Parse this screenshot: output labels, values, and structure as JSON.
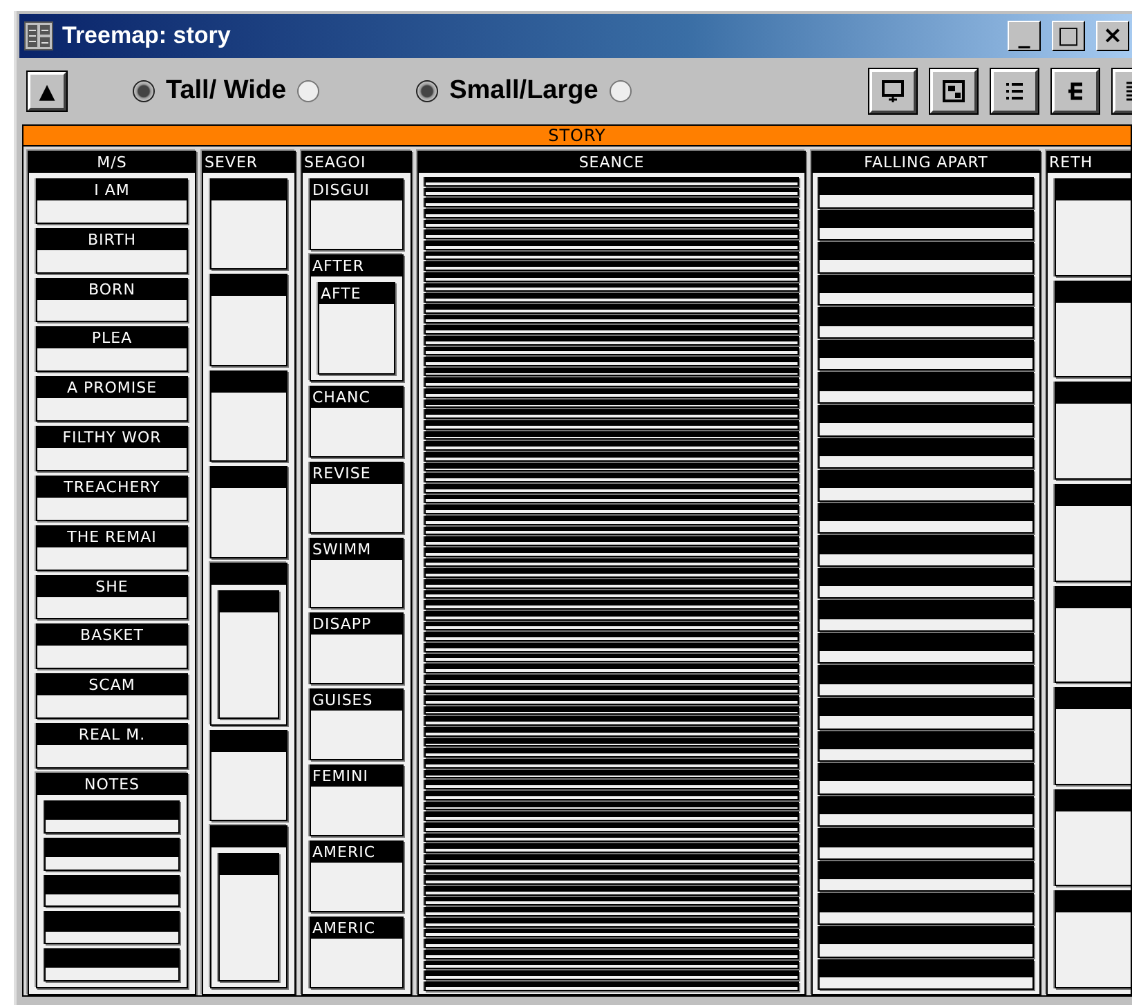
{
  "window": {
    "title": "Treemap: story",
    "controls": [
      "_",
      "□",
      "×"
    ]
  },
  "toolbar": {
    "up_button": "▲",
    "toggles": [
      {
        "label": "Tall/ Wide",
        "options": [
          {
            "selected": true
          },
          {
            "selected": false
          }
        ]
      },
      {
        "label": "Small/Large",
        "options": [
          {
            "selected": true
          },
          {
            "selected": false
          }
        ]
      }
    ],
    "tools": [
      {
        "kind": "presentation"
      },
      {
        "kind": "layout"
      },
      {
        "kind": "list"
      },
      {
        "kind": "tree"
      },
      {
        "kind": "text"
      }
    ]
  },
  "treemap": {
    "label": "STORY",
    "children": [
      {
        "kind": "group",
        "label": "M/S",
        "children": [
          {
            "kind": "leaf",
            "label": "I AM"
          },
          {
            "kind": "leaf",
            "label": "BIRTH"
          },
          {
            "kind": "leaf",
            "label": "BORN"
          },
          {
            "kind": "leaf",
            "label": "PLEA"
          },
          {
            "kind": "leaf",
            "label": "A PROMISE"
          },
          {
            "kind": "leaf",
            "label": "FILTHY WOR"
          },
          {
            "kind": "leaf",
            "label": "TREACHERY"
          },
          {
            "kind": "leaf",
            "label": "THE REMAI"
          },
          {
            "kind": "leaf",
            "label": "SHE"
          },
          {
            "kind": "leaf",
            "label": "BASKET"
          },
          {
            "kind": "leaf",
            "label": "SCAM"
          },
          {
            "kind": "leaf",
            "label": "REAL M."
          },
          {
            "kind": "group",
            "label": "NOTES",
            "children": [
              {
                "kind": "leaf"
              },
              {
                "kind": "leaf"
              },
              {
                "kind": "leaf"
              },
              {
                "kind": "leaf"
              },
              {
                "kind": "leaf"
              }
            ]
          }
        ]
      },
      {
        "kind": "group",
        "label": "SEVER",
        "children": [
          {
            "kind": "leaf"
          },
          {
            "kind": "leaf"
          },
          {
            "kind": "leaf"
          },
          {
            "kind": "leaf"
          },
          {
            "kind": "group",
            "children": [
              {
                "kind": "leaf"
              }
            ]
          },
          {
            "kind": "leaf"
          },
          {
            "kind": "group",
            "children": [
              {
                "kind": "leaf"
              }
            ]
          }
        ]
      },
      {
        "kind": "group",
        "label": "SEAGOI",
        "children": [
          {
            "kind": "leaf",
            "label": "DISGUI"
          },
          {
            "kind": "group",
            "label": "AFTER",
            "children": [
              {
                "kind": "leaf",
                "label": "AFTE"
              }
            ]
          },
          {
            "kind": "leaf",
            "label": "CHANC"
          },
          {
            "kind": "leaf",
            "label": "REVISE"
          },
          {
            "kind": "leaf",
            "label": "SWIMM"
          },
          {
            "kind": "leaf",
            "label": "DISAPP"
          },
          {
            "kind": "leaf",
            "label": "GUISES"
          },
          {
            "kind": "leaf",
            "label": "FEMINI"
          },
          {
            "kind": "leaf",
            "label": "AMERIC"
          },
          {
            "kind": "leaf",
            "label": "AMERIC"
          }
        ]
      },
      {
        "kind": "group",
        "label": "SEANCE",
        "children": [
          {
            "kind": "leaf"
          },
          {
            "kind": "leaf"
          },
          {
            "kind": "leaf"
          },
          {
            "kind": "leaf"
          },
          {
            "kind": "leaf"
          },
          {
            "kind": "leaf"
          },
          {
            "kind": "leaf"
          },
          {
            "kind": "leaf"
          },
          {
            "kind": "leaf"
          },
          {
            "kind": "leaf"
          },
          {
            "kind": "leaf"
          },
          {
            "kind": "leaf"
          },
          {
            "kind": "leaf"
          },
          {
            "kind": "leaf"
          },
          {
            "kind": "leaf"
          },
          {
            "kind": "leaf"
          },
          {
            "kind": "leaf"
          },
          {
            "kind": "leaf"
          },
          {
            "kind": "leaf"
          },
          {
            "kind": "leaf"
          },
          {
            "kind": "leaf"
          },
          {
            "kind": "leaf"
          },
          {
            "kind": "leaf"
          },
          {
            "kind": "leaf"
          },
          {
            "kind": "leaf"
          },
          {
            "kind": "leaf"
          },
          {
            "kind": "leaf"
          },
          {
            "kind": "leaf"
          },
          {
            "kind": "leaf"
          },
          {
            "kind": "leaf"
          },
          {
            "kind": "leaf"
          },
          {
            "kind": "leaf"
          },
          {
            "kind": "leaf"
          },
          {
            "kind": "leaf"
          },
          {
            "kind": "leaf"
          },
          {
            "kind": "leaf"
          },
          {
            "kind": "leaf"
          },
          {
            "kind": "leaf"
          },
          {
            "kind": "leaf"
          },
          {
            "kind": "leaf"
          },
          {
            "kind": "leaf"
          },
          {
            "kind": "leaf"
          },
          {
            "kind": "leaf"
          },
          {
            "kind": "leaf"
          },
          {
            "kind": "leaf"
          },
          {
            "kind": "leaf"
          },
          {
            "kind": "leaf"
          },
          {
            "kind": "leaf"
          },
          {
            "kind": "leaf"
          },
          {
            "kind": "leaf"
          },
          {
            "kind": "leaf"
          },
          {
            "kind": "leaf"
          },
          {
            "kind": "leaf"
          },
          {
            "kind": "leaf"
          },
          {
            "kind": "leaf"
          },
          {
            "kind": "leaf"
          },
          {
            "kind": "leaf"
          },
          {
            "kind": "leaf"
          },
          {
            "kind": "leaf"
          },
          {
            "kind": "leaf"
          },
          {
            "kind": "leaf"
          },
          {
            "kind": "leaf"
          },
          {
            "kind": "leaf"
          },
          {
            "kind": "leaf"
          },
          {
            "kind": "leaf"
          },
          {
            "kind": "leaf"
          },
          {
            "kind": "leaf"
          },
          {
            "kind": "leaf"
          },
          {
            "kind": "leaf"
          },
          {
            "kind": "leaf"
          },
          {
            "kind": "leaf"
          },
          {
            "kind": "leaf"
          },
          {
            "kind": "leaf"
          },
          {
            "kind": "leaf"
          },
          {
            "kind": "leaf"
          },
          {
            "kind": "leaf"
          },
          {
            "kind": "leaf"
          }
        ]
      },
      {
        "kind": "group",
        "label": "FALLING APART",
        "children": [
          {
            "kind": "leaf"
          },
          {
            "kind": "leaf"
          },
          {
            "kind": "leaf"
          },
          {
            "kind": "leaf"
          },
          {
            "kind": "leaf"
          },
          {
            "kind": "leaf"
          },
          {
            "kind": "leaf"
          },
          {
            "kind": "leaf"
          },
          {
            "kind": "leaf"
          },
          {
            "kind": "leaf"
          },
          {
            "kind": "leaf"
          },
          {
            "kind": "leaf"
          },
          {
            "kind": "leaf"
          },
          {
            "kind": "leaf"
          },
          {
            "kind": "leaf"
          },
          {
            "kind": "leaf"
          },
          {
            "kind": "leaf"
          },
          {
            "kind": "leaf"
          },
          {
            "kind": "leaf"
          },
          {
            "kind": "leaf"
          },
          {
            "kind": "leaf"
          },
          {
            "kind": "leaf"
          },
          {
            "kind": "leaf"
          },
          {
            "kind": "leaf"
          },
          {
            "kind": "leaf"
          }
        ]
      },
      {
        "kind": "group",
        "label": "RETH",
        "children": [
          {
            "kind": "leaf"
          },
          {
            "kind": "leaf"
          },
          {
            "kind": "leaf"
          },
          {
            "kind": "leaf"
          },
          {
            "kind": "leaf"
          },
          {
            "kind": "leaf"
          },
          {
            "kind": "leaf"
          },
          {
            "kind": "leaf"
          }
        ]
      }
    ]
  }
}
